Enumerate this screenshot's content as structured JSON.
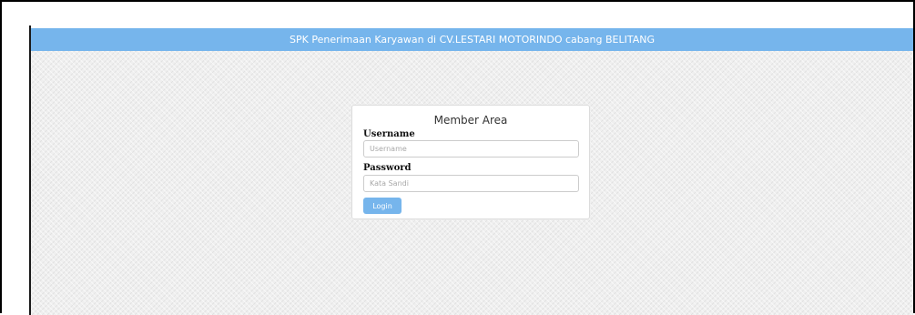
{
  "header": {
    "title": "SPK Penerimaan Karyawan di CV.LESTARI MOTORINDO cabang BELITANG"
  },
  "login": {
    "title": "Member Area",
    "username_label": "Username",
    "username_placeholder": "Username",
    "username_value": "",
    "password_label": "Password",
    "password_placeholder": "Kata Sandi",
    "password_value": "",
    "login_button": "Login"
  },
  "colors": {
    "accent": "#76b5ec",
    "background": "#efefef",
    "panel": "#ffffff"
  }
}
